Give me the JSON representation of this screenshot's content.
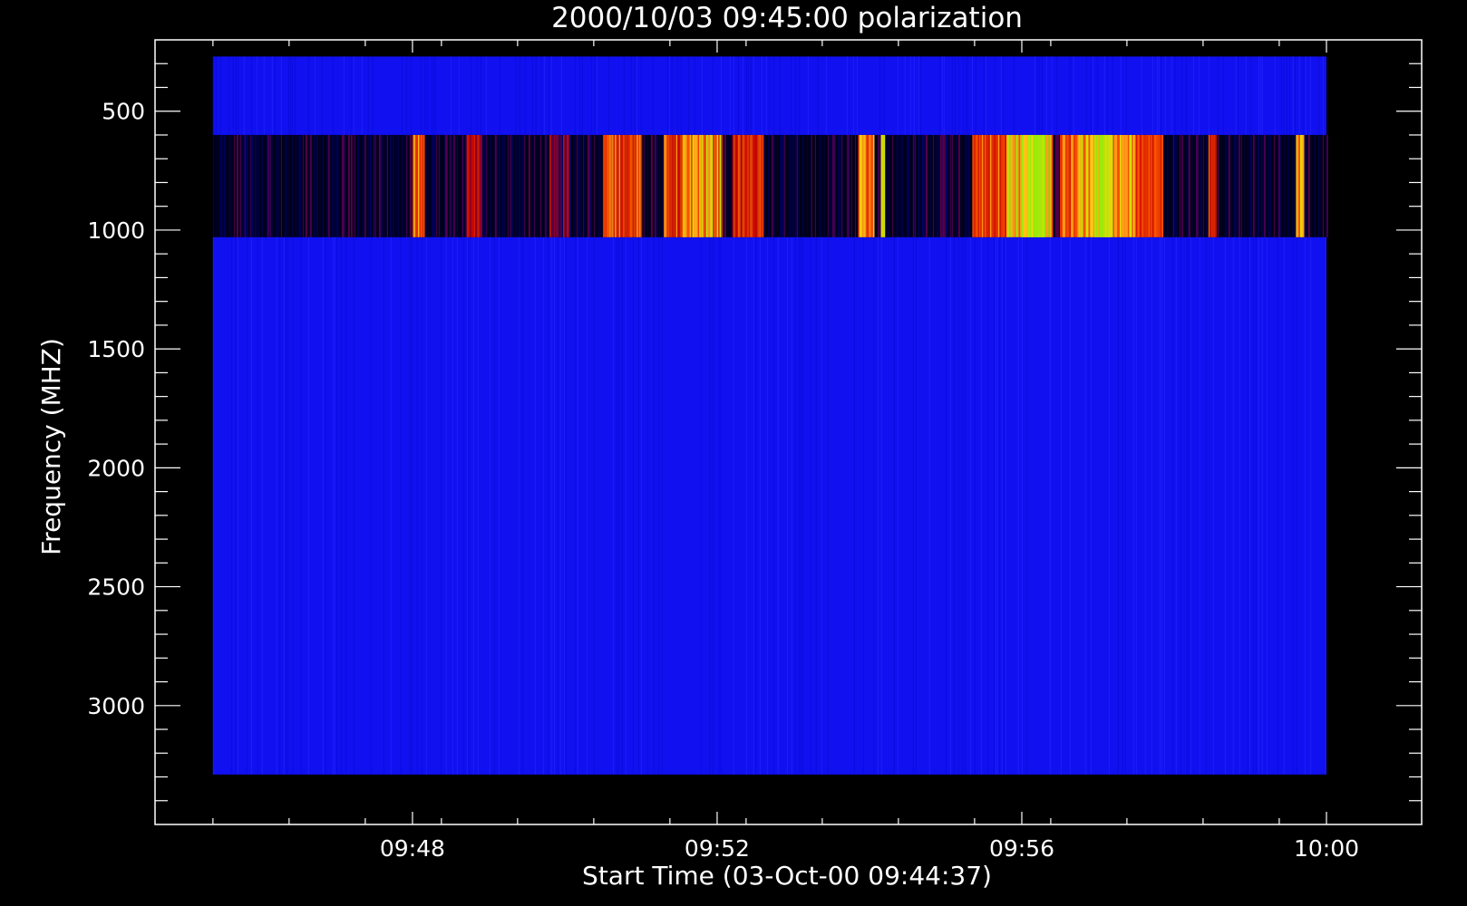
{
  "chart_data": {
    "type": "heatmap",
    "title": "2000/10/03 09:45:00 polarization",
    "xlabel": "Start Time (03-Oct-00 09:44:37)",
    "ylabel": "Frequency (MHZ)",
    "x_ticks": [
      "09:48",
      "09:52",
      "09:56",
      "10:00"
    ],
    "x_tick_minutes": [
      228,
      232,
      236,
      240
    ],
    "x_range_minutes": [
      224.62,
      241.25
    ],
    "data_range_minutes": [
      225.38,
      240.0
    ],
    "y_ticks": [
      500,
      1000,
      1500,
      2000,
      2500,
      3000
    ],
    "y_range": [
      200,
      3500
    ],
    "y_inverted": true,
    "grid": false,
    "bands": [
      {
        "f_start": 270,
        "f_end": 600,
        "style": "blue"
      },
      {
        "f_start": 600,
        "f_end": 1030,
        "style": "intensity"
      },
      {
        "f_start": 1030,
        "f_end": 3290,
        "style": "blue"
      }
    ],
    "intensity_events": [
      {
        "t_start": 228.0,
        "t_end": 228.15,
        "level": 0.62
      },
      {
        "t_start": 228.7,
        "t_end": 228.9,
        "level": 0.35
      },
      {
        "t_start": 229.8,
        "t_end": 230.05,
        "level": 0.3
      },
      {
        "t_start": 230.5,
        "t_end": 230.55,
        "level": 0.55
      },
      {
        "t_start": 230.55,
        "t_end": 231.0,
        "level": 0.6
      },
      {
        "t_start": 231.3,
        "t_end": 231.8,
        "level": 0.55
      },
      {
        "t_start": 231.55,
        "t_end": 232.05,
        "level": 0.75
      },
      {
        "t_start": 232.2,
        "t_end": 232.6,
        "level": 0.5
      },
      {
        "t_start": 233.85,
        "t_end": 234.05,
        "level": 0.7
      },
      {
        "t_start": 234.15,
        "t_end": 234.2,
        "level": 0.8
      },
      {
        "t_start": 235.35,
        "t_end": 235.8,
        "level": 0.55
      },
      {
        "t_start": 235.8,
        "t_end": 236.4,
        "level": 0.8
      },
      {
        "t_start": 236.0,
        "t_end": 236.3,
        "level": 0.9
      },
      {
        "t_start": 236.5,
        "t_end": 236.75,
        "level": 0.6
      },
      {
        "t_start": 236.75,
        "t_end": 237.5,
        "level": 0.8
      },
      {
        "t_start": 236.95,
        "t_end": 237.15,
        "level": 0.9
      },
      {
        "t_start": 237.5,
        "t_end": 237.85,
        "level": 0.55
      },
      {
        "t_start": 238.45,
        "t_end": 238.55,
        "level": 0.55
      },
      {
        "t_start": 239.6,
        "t_end": 239.7,
        "level": 0.75
      }
    ],
    "colors": {
      "background": "#000000",
      "blue_band": "#1010f0",
      "axes": "#ffffff"
    }
  }
}
